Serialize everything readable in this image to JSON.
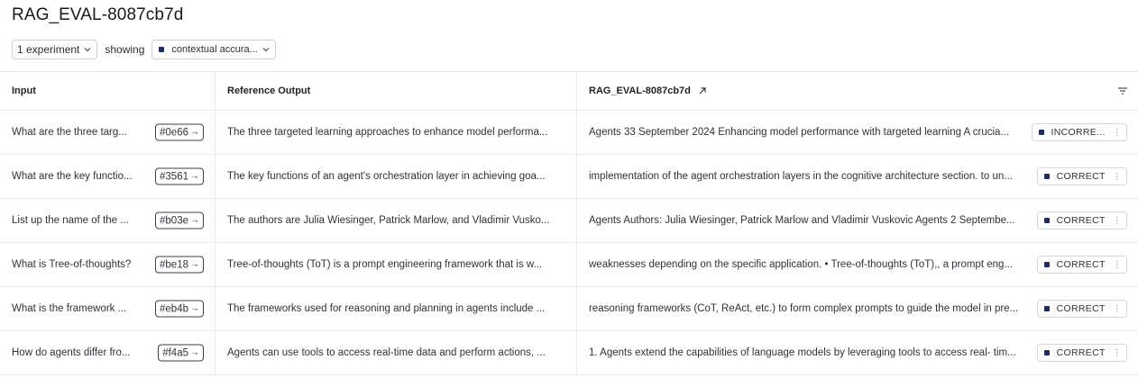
{
  "page_title": "RAG_EVAL-8087cb7d",
  "controls": {
    "experiment_select": "1 experiment",
    "showing_label": "showing",
    "metric_select": "contextual accura..."
  },
  "table": {
    "headers": {
      "input": "Input",
      "reference": "Reference Output",
      "experiment": "RAG_EVAL-8087cb7d"
    },
    "rows": [
      {
        "input": "What are the three targ...",
        "id": "#0e66",
        "reference": "The three targeted learning approaches to enhance model performa...",
        "output": "Agents 33 September 2024 Enhancing model performance with targeted learning A crucia...",
        "verdict": "INCORRE..."
      },
      {
        "input": "What are the key functio...",
        "id": "#3561",
        "reference": "The key functions of an agent's orchestration layer in achieving goa...",
        "output": "implementation of the agent orchestration layers in the cognitive architecture section. to un...",
        "verdict": "CORRECT"
      },
      {
        "input": "List up the name of the ...",
        "id": "#b03e",
        "reference": "The authors are Julia Wiesinger, Patrick Marlow, and Vladimir Vusko...",
        "output": "Agents Authors: Julia Wiesinger, Patrick Marlow and Vladimir Vuskovic Agents 2 Septembe...",
        "verdict": "CORRECT"
      },
      {
        "input": "What is Tree-of-thoughts?",
        "id": "#be18",
        "reference": "Tree-of-thoughts (ToT) is a prompt engineering framework that is w...",
        "output": "weaknesses depending on the specific application. • Tree-of-thoughts (ToT),, a prompt eng...",
        "verdict": "CORRECT"
      },
      {
        "input": "What is the framework ...",
        "id": "#eb4b",
        "reference": "The frameworks used for reasoning and planning in agents include ...",
        "output": "reasoning frameworks (CoT, ReAct, etc.) to form complex prompts to guide the model in pre...",
        "verdict": "CORRECT"
      },
      {
        "input": "How do agents differ fro...",
        "id": "#f4a5",
        "reference": "Agents can use tools to access real-time data and perform actions, ...",
        "output": "1. Agents extend the capabilities of language models by leveraging tools to access real- tim...",
        "verdict": "CORRECT"
      }
    ]
  },
  "colors": {
    "metric_square": "#1d2b6b",
    "border": "#e8eaed"
  },
  "icons": {
    "experiment_chevron": "chevron-down-icon",
    "external_link": "external-link-icon",
    "filter": "filter-icon",
    "id_arrow": "arrow-right-icon",
    "verdict_menu": "more-vertical-icon"
  }
}
